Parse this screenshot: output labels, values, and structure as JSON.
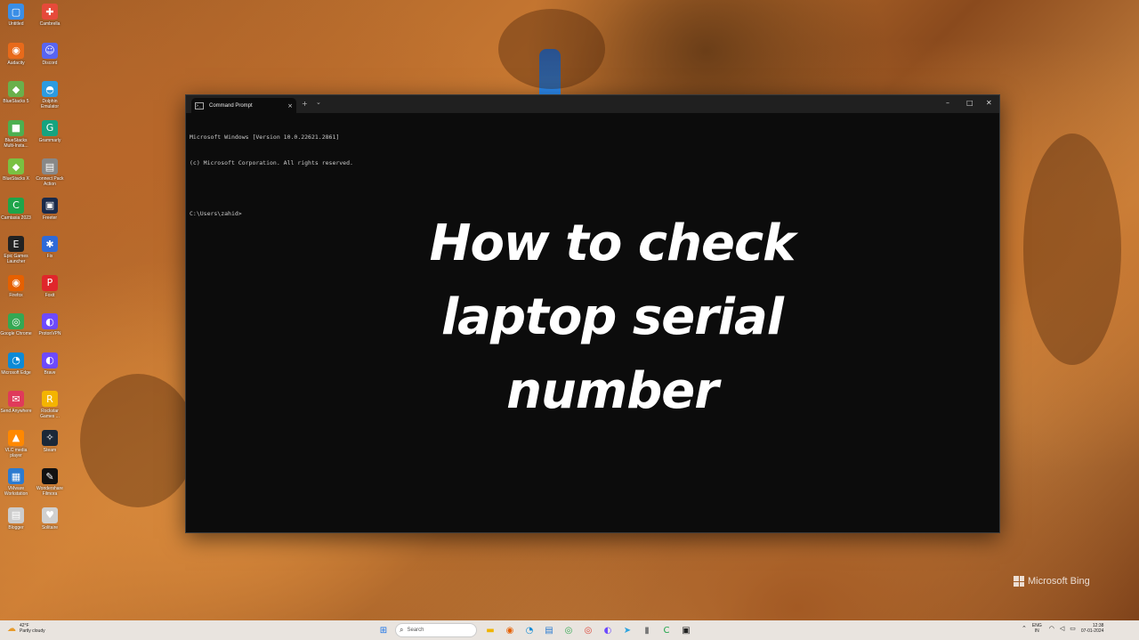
{
  "desktop": {
    "icons": [
      {
        "label": "Untitled",
        "color": "#3a8ee6",
        "glyph": "▢"
      },
      {
        "label": "Cambrella",
        "color": "#e64a3a",
        "glyph": "✚"
      },
      {
        "label": "Audacity",
        "color": "#e86a1a",
        "glyph": "◉"
      },
      {
        "label": "Discord",
        "color": "#5865f2",
        "glyph": "☺"
      },
      {
        "label": "BlueStacks 5",
        "color": "#6ab04c",
        "glyph": "◆"
      },
      {
        "label": "Dolphin Emulator",
        "color": "#2d9be0",
        "glyph": "◓"
      },
      {
        "label": "BlueStacks Multi-Insta...",
        "color": "#4caf50",
        "glyph": "■"
      },
      {
        "label": "Grammarly",
        "color": "#15a37f",
        "glyph": "G"
      },
      {
        "label": "BlueStacks X",
        "color": "#7ac142",
        "glyph": "◆"
      },
      {
        "label": "Connect Pack Action",
        "color": "#888888",
        "glyph": "▤"
      },
      {
        "label": "Camtasia 2023",
        "color": "#1ea54a",
        "glyph": "C"
      },
      {
        "label": "Freeter",
        "color": "#1a2a4a",
        "glyph": "▣"
      },
      {
        "label": "Epic Games Launcher",
        "color": "#222222",
        "glyph": "E"
      },
      {
        "label": "Fix",
        "color": "#2f6ad8",
        "glyph": "✱"
      },
      {
        "label": "Firefox",
        "color": "#e66000",
        "glyph": "◉"
      },
      {
        "label": "Foxit",
        "color": "#e0262b",
        "glyph": "P"
      },
      {
        "label": "Google Chrome",
        "color": "#34a853",
        "glyph": "◎"
      },
      {
        "label": "ProtonVPN",
        "color": "#6d4aff",
        "glyph": "◐"
      },
      {
        "label": "Microsoft Edge",
        "color": "#0c8ad6",
        "glyph": "◔"
      },
      {
        "label": "Brave",
        "color": "#6d4aff",
        "glyph": "◐"
      },
      {
        "label": "Send Anywhere",
        "color": "#e03a5a",
        "glyph": "✉"
      },
      {
        "label": "Rockstar Games ...",
        "color": "#f4b400",
        "glyph": "R"
      },
      {
        "label": "VLC media player",
        "color": "#ff8800",
        "glyph": "▲"
      },
      {
        "label": "Steam",
        "color": "#1b2838",
        "glyph": "✧"
      },
      {
        "label": "VMware Workstation",
        "color": "#2b7bd0",
        "glyph": "▦"
      },
      {
        "label": "Wondershare Filmora",
        "color": "#111111",
        "glyph": "✎"
      },
      {
        "label": "Blogger",
        "color": "#cccccc",
        "glyph": "▤"
      },
      {
        "label": "Solitaire",
        "color": "#d0d0d0",
        "glyph": "♥"
      }
    ]
  },
  "window": {
    "tab_title": "Command Prompt",
    "tab_close": "×",
    "new_tab": "+",
    "dropdown": "⌄",
    "minimize": "–",
    "maximize": "□",
    "close": "✕",
    "terminal_lines": [
      "Microsoft Windows [Version 10.0.22621.2861]",
      "(c) Microsoft Corporation. All rights reserved.",
      "",
      "C:\\Users\\zahid>"
    ]
  },
  "overlay": {
    "line1": "How to check",
    "line2": "laptop serial",
    "line3": "number"
  },
  "watermark": {
    "text": "Microsoft Bing"
  },
  "taskbar": {
    "weather_temp": "42°F",
    "weather_desc": "Partly cloudy",
    "search_placeholder": "Search",
    "apps": [
      {
        "name": "windows-start-icon",
        "glyph": "⊞",
        "color": "#1a73e8"
      },
      {
        "name": "file-explorer-icon",
        "glyph": "▬",
        "color": "#f0b400"
      },
      {
        "name": "firefox-icon",
        "glyph": "◉",
        "color": "#e66000"
      },
      {
        "name": "edge-icon",
        "glyph": "◔",
        "color": "#0c8ad6"
      },
      {
        "name": "notepad-icon",
        "glyph": "▤",
        "color": "#2b7bd0"
      },
      {
        "name": "chrome-icon",
        "glyph": "◎",
        "color": "#34a853"
      },
      {
        "name": "chrome-badge-icon",
        "glyph": "◎",
        "color": "#db4437"
      },
      {
        "name": "vpn-icon",
        "glyph": "◐",
        "color": "#6d4aff"
      },
      {
        "name": "telegram-icon",
        "glyph": "➤",
        "color": "#2aa3df"
      },
      {
        "name": "microphone-icon",
        "glyph": "▮",
        "color": "#777777"
      },
      {
        "name": "camtasia-icon",
        "glyph": "C",
        "color": "#1ea54a"
      },
      {
        "name": "terminal-icon",
        "glyph": "▣",
        "color": "#222222"
      }
    ],
    "tray_lang": "ENG",
    "tray_region": "IN",
    "time": "12:38",
    "date": "07-01-2024"
  }
}
